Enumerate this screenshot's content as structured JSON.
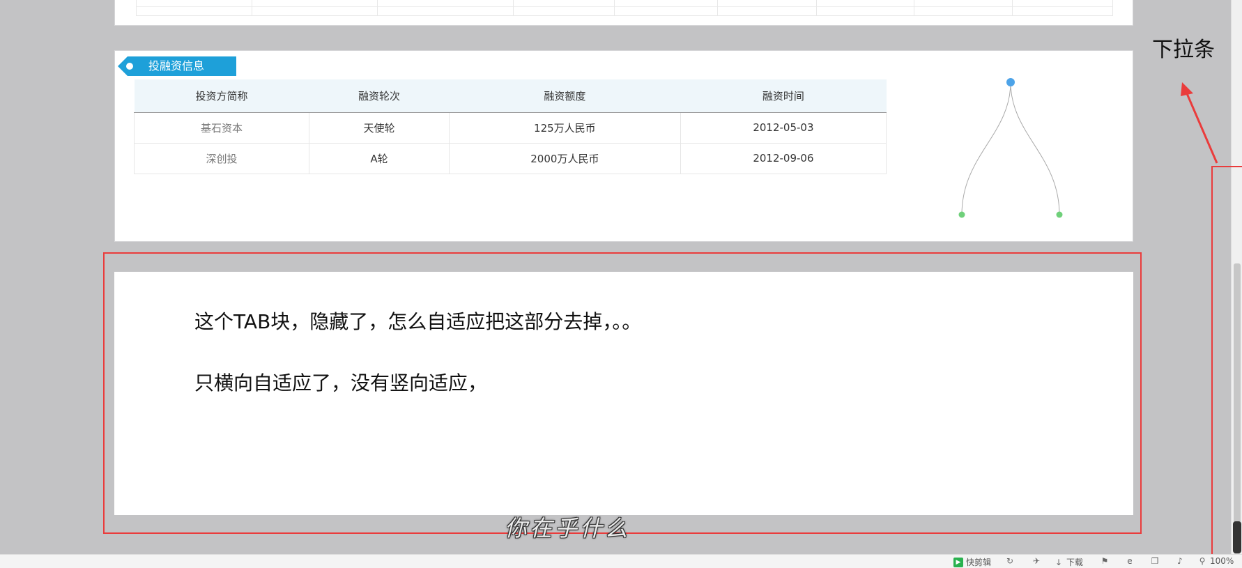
{
  "invest_section": {
    "tag": "投融资信息",
    "columns": [
      "投资方简称",
      "融资轮次",
      "融资额度",
      "融资时间"
    ],
    "rows": [
      [
        "基石资本",
        "天使轮",
        "125万人民币",
        "2012-05-03"
      ],
      [
        "深创投",
        "A轮",
        "2000万人民币",
        "2012-09-06"
      ]
    ],
    "tree_colors": {
      "root": "#4da3e8",
      "leaf": "#6fd07a",
      "line": "#aaaaaa"
    }
  },
  "message": {
    "line1": "这个TAB块，隐藏了，怎么自适应把这部分去掉，。。",
    "line2": "只横向自适应了，没有竖向适应，"
  },
  "caption": "你在乎什么",
  "annotation": {
    "label": "下拉条",
    "color": "#ea3c3c"
  },
  "status_bar": {
    "kuaijianji": "快剪辑",
    "download": "下载",
    "zoom": "100%"
  }
}
